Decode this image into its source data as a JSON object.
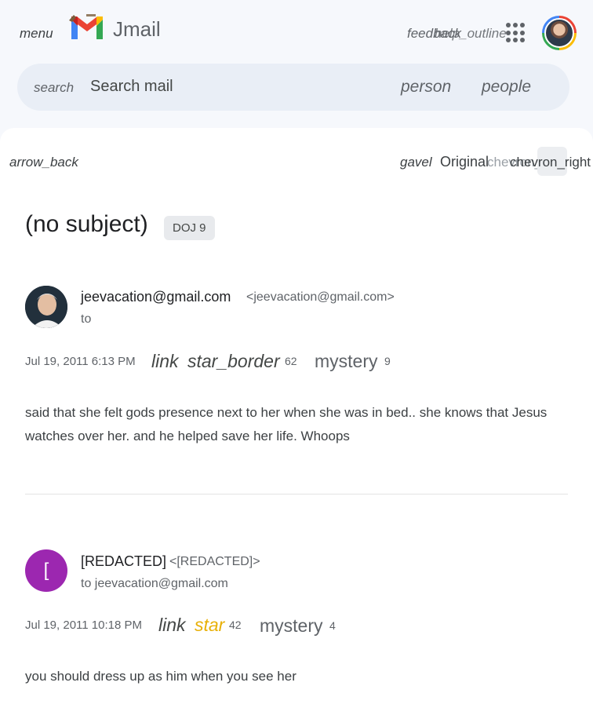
{
  "header": {
    "menu_label": "menu",
    "app_name": "Jmail",
    "feedback_label": "feedback",
    "help_label": "help_outline"
  },
  "search": {
    "icon_label": "search",
    "placeholder": "Search mail",
    "person_label": "person",
    "people_label": "people"
  },
  "toolbar": {
    "back_label": "arrow_back",
    "gavel_label": "gavel",
    "original_label": "Original",
    "chevron_left_label": "chevron_left",
    "chevron_right_label": "chevron_right"
  },
  "thread": {
    "subject": "(no subject)",
    "tag": "DOJ 9"
  },
  "messages": [
    {
      "sender": "jeevacation@gmail.com",
      "address": "<jeevacation@gmail.com>",
      "to": "to",
      "date": "Jul 19, 2011 6:13 PM",
      "link_label": "link",
      "star_label": "star_border",
      "star_count": "62",
      "mystery_label": "mystery",
      "mystery_count": "9",
      "body": "said that she felt gods presence next to her when she was in bed.. she knows that Jesus watches over her. and he helped save her life. Whoops"
    },
    {
      "avatar_letter": "[",
      "sender": "[REDACTED]",
      "address": "<[REDACTED]>",
      "to": "to jeevacation@gmail.com",
      "date": "Jul 19, 2011 10:18 PM",
      "link_label": "link",
      "star_label": "star",
      "star_count": "42",
      "mystery_label": "mystery",
      "mystery_count": "4",
      "body": "you should dress up as him when you see her"
    }
  ],
  "colors": {
    "page_bg": "#f6f8fc",
    "search_bg": "#e9eef6",
    "starred": "#e8b007",
    "avatar_purple": "#9c27b0"
  }
}
